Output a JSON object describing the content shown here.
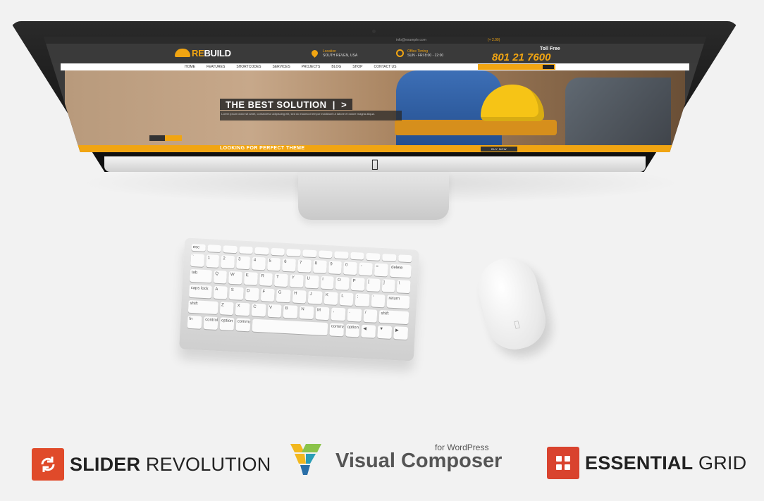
{
  "screen": {
    "topbar": {
      "email": "info@example.com",
      "lang": "(+ 2.00)"
    },
    "logo": {
      "prefix": "RE",
      "suffix": "BUILD"
    },
    "location": {
      "label": "Location",
      "value": "SOUTH REVEN, USA"
    },
    "timing": {
      "label": "Office Timing",
      "value": "SUN - FRI 8:00 - 22:00"
    },
    "toll_free": "Toll Free",
    "phone": "801 21 7600",
    "nav": [
      "HOME",
      "FEATURES",
      "SHORTCODES",
      "SERVICES",
      "PROJECTS",
      "BLOG",
      "SHOP",
      "CONTACT US"
    ],
    "search_placeholder": "Search...",
    "hero_title": "THE BEST SOLUTION",
    "hero_text": "Lorem ipsum dolor sit amet, consectetur adipiscing elit, sed do eiusmod tempor incididunt ut labore et dolore magna aliqua.",
    "footer_text": "LOOKING FOR PERFECT THEME",
    "footer_button": "BUY NOW"
  },
  "plugins": {
    "slider_revolution": {
      "bold": "SLIDER",
      "light": "REVOLUTION"
    },
    "visual_composer": {
      "tag": "for WordPress",
      "name": "Visual Composer"
    },
    "essential_grid": {
      "bold": "ESSENTIAL",
      "light": "GRID"
    }
  },
  "colors": {
    "accent": "#f1a512",
    "slider_red": "#e04a2a",
    "grid_red": "#d9432e"
  }
}
